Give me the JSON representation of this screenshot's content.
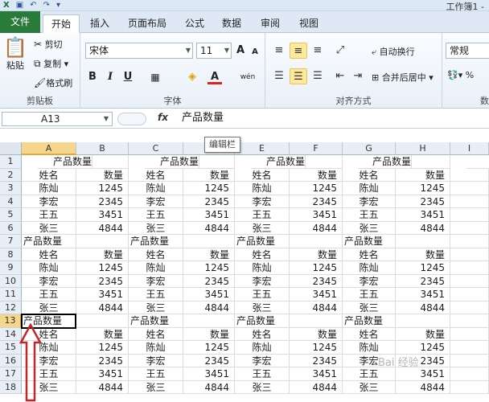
{
  "window": {
    "title": "工作簿1 -"
  },
  "tabs": [
    {
      "label": "文件"
    },
    {
      "label": "开始"
    },
    {
      "label": "插入"
    },
    {
      "label": "页面布局"
    },
    {
      "label": "公式"
    },
    {
      "label": "数据"
    },
    {
      "label": "审阅"
    },
    {
      "label": "视图"
    }
  ],
  "ribbon": {
    "clipboard": {
      "paste": "粘贴",
      "cut": "剪切",
      "copy": "复制",
      "format_painter": "格式刷",
      "label": "剪贴板"
    },
    "font": {
      "name": "宋体",
      "size": "11",
      "grow": "A",
      "shrink": "A",
      "bold": "B",
      "italic": "I",
      "underline": "U",
      "font_color": "A",
      "phonetic": "wén",
      "label": "字体"
    },
    "alignment": {
      "wrap": "自动换行",
      "merge": "合并后居中",
      "label": "对齐方式"
    },
    "number": {
      "format": "常规",
      "label": "数"
    }
  },
  "formula_bar": {
    "name_box": "A13",
    "fx": "fx",
    "content": "产品数量"
  },
  "tooltip": "编辑栏",
  "columns": [
    "A",
    "B",
    "C",
    "D",
    "E",
    "F",
    "G",
    "H",
    "I"
  ],
  "rows": [
    [
      "产品数量",
      "",
      "产品数量",
      "",
      "产品数量",
      "",
      "产品数量",
      "",
      ""
    ],
    [
      "姓名",
      "数量",
      "姓名",
      "数量",
      "姓名",
      "数量",
      "姓名",
      "数量",
      ""
    ],
    [
      "陈灿",
      "1245",
      "陈灿",
      "1245",
      "陈灿",
      "1245",
      "陈灿",
      "1245",
      ""
    ],
    [
      "李宏",
      "2345",
      "李宏",
      "2345",
      "李宏",
      "2345",
      "李宏",
      "2345",
      ""
    ],
    [
      "王五",
      "3451",
      "王五",
      "3451",
      "王五",
      "3451",
      "王五",
      "3451",
      ""
    ],
    [
      "张三",
      "4844",
      "张三",
      "4844",
      "张三",
      "4844",
      "张三",
      "4844",
      ""
    ],
    [
      "产品数量",
      "",
      "产品数量",
      "",
      "产品数量",
      "",
      "产品数量",
      "",
      ""
    ],
    [
      "姓名",
      "数量",
      "姓名",
      "数量",
      "姓名",
      "数量",
      "姓名",
      "数量",
      ""
    ],
    [
      "陈灿",
      "1245",
      "陈灿",
      "1245",
      "陈灿",
      "1245",
      "陈灿",
      "1245",
      ""
    ],
    [
      "李宏",
      "2345",
      "李宏",
      "2345",
      "李宏",
      "2345",
      "李宏",
      "2345",
      ""
    ],
    [
      "王五",
      "3451",
      "王五",
      "3451",
      "王五",
      "3451",
      "王五",
      "3451",
      ""
    ],
    [
      "张三",
      "4844",
      "张三",
      "4844",
      "张三",
      "4844",
      "张三",
      "4844",
      ""
    ],
    [
      "产品数量",
      "",
      "产品数量",
      "",
      "产品数量",
      "",
      "产品数量",
      "",
      ""
    ],
    [
      "姓名",
      "数量",
      "姓名",
      "数量",
      "姓名",
      "数量",
      "姓名",
      "数量",
      ""
    ],
    [
      "陈灿",
      "1245",
      "陈灿",
      "1245",
      "陈灿",
      "1245",
      "陈灿",
      "1245",
      ""
    ],
    [
      "李宏",
      "2345",
      "李宏",
      "2345",
      "李宏",
      "2345",
      "李宏",
      "2345",
      ""
    ],
    [
      "王五",
      "3451",
      "王五",
      "3451",
      "王五",
      "3451",
      "王五",
      "3451",
      ""
    ],
    [
      "张三",
      "4844",
      "张三",
      "4844",
      "张三",
      "4844",
      "张三",
      "4844",
      ""
    ]
  ],
  "row_numbers": [
    "1",
    "2",
    "3",
    "4",
    "5",
    "6",
    "7",
    "8",
    "9",
    "10",
    "11",
    "12",
    "13",
    "14",
    "15",
    "16",
    "17",
    "18"
  ],
  "selection": {
    "cell": "A13",
    "column": "A",
    "row": "13"
  },
  "watermark": "Bai 经验",
  "colors": {
    "file_tab": "#2a7a3a",
    "selection_header": "#f6d58c",
    "arrow": "#c0282d"
  }
}
